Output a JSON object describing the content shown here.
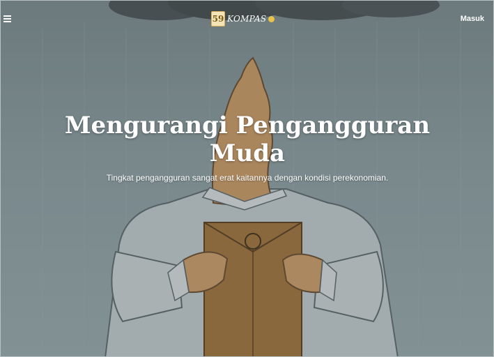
{
  "header": {
    "menu_icon": "hamburger-menu-icon",
    "logo": {
      "badge": "59",
      "name": "KOMPAS",
      "seal_icon": "kompas-seal-icon"
    },
    "login_label": "Masuk"
  },
  "article": {
    "title": "Mengurangi Pengangguran Muda",
    "deck": "Tingkat pengangguran sangat erat kaitannya dengan kondisi perekonomian."
  },
  "colors": {
    "background_teal": "#8fa3a6",
    "envelope": "#b07a3a",
    "shirt": "#dfe5e6",
    "skin": "#d9a56b"
  }
}
